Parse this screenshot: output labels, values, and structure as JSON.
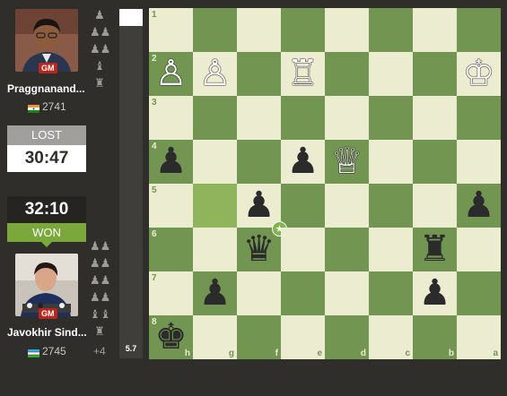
{
  "top_player": {
    "title_badge": "GM",
    "name": "Praggnanand...",
    "rating": "2741",
    "flag": "india",
    "status": "LOST",
    "clock": "30:47",
    "captured": [
      "♟",
      "♟♟",
      "♟♟",
      "♝",
      "♜"
    ]
  },
  "bottom_player": {
    "title_badge": "GM",
    "name": "Javokhir Sind...",
    "rating": "2745",
    "flag": "uzbekistan",
    "status": "WON",
    "clock": "32:10",
    "captured": [
      "♟♟",
      "♟♟",
      "♟♟",
      "♟♟",
      "♝♝",
      "♜"
    ],
    "advantage": "+4"
  },
  "eval": {
    "value": "5.7"
  },
  "board": {
    "orientation": "black-bottom",
    "rank_labels": [
      "1",
      "2",
      "3",
      "4",
      "5",
      "6",
      "7",
      "8"
    ],
    "file_labels": [
      "h",
      "g",
      "f",
      "e",
      "d",
      "c",
      "b",
      "a"
    ],
    "pieces": [
      {
        "sq": "h2",
        "piece": "wP"
      },
      {
        "sq": "g2",
        "piece": "wP"
      },
      {
        "sq": "e2",
        "piece": "wR"
      },
      {
        "sq": "a2",
        "piece": "wK"
      },
      {
        "sq": "h4",
        "piece": "bP"
      },
      {
        "sq": "e4",
        "piece": "bP"
      },
      {
        "sq": "d4",
        "piece": "wQ"
      },
      {
        "sq": "f5",
        "piece": "bP"
      },
      {
        "sq": "a5",
        "piece": "bP"
      },
      {
        "sq": "f6",
        "piece": "bQ"
      },
      {
        "sq": "b6",
        "piece": "bR"
      },
      {
        "sq": "g7",
        "piece": "bP"
      },
      {
        "sq": "b7",
        "piece": "bP"
      },
      {
        "sq": "h8",
        "piece": "bK"
      }
    ],
    "highlighted_squares": [
      "g5"
    ],
    "best_move_square": "f6"
  }
}
